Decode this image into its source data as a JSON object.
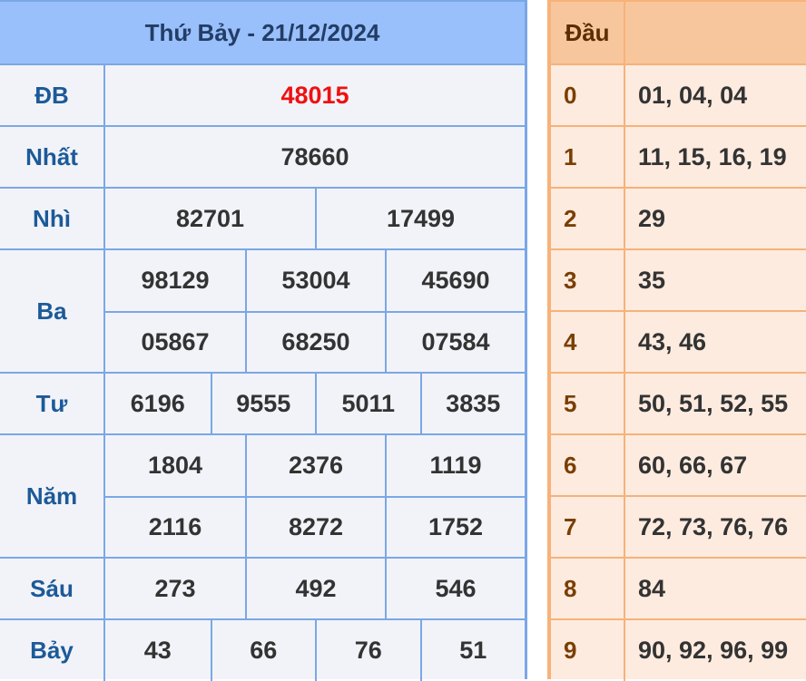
{
  "header": {
    "title": "Thứ Bảy - 21/12/2024"
  },
  "prizes": {
    "db": {
      "label": "ĐB",
      "values": [
        "48015"
      ]
    },
    "nhat": {
      "label": "Nhất",
      "values": [
        "78660"
      ]
    },
    "nhi": {
      "label": "Nhì",
      "values": [
        "82701",
        "17499"
      ]
    },
    "ba": {
      "label": "Ba",
      "values": [
        "98129",
        "53004",
        "45690",
        "05867",
        "68250",
        "07584"
      ]
    },
    "tu": {
      "label": "Tư",
      "values": [
        "6196",
        "9555",
        "5011",
        "3835"
      ]
    },
    "nam": {
      "label": "Năm",
      "values": [
        "1804",
        "2376",
        "1119",
        "2116",
        "8272",
        "1752"
      ]
    },
    "sau": {
      "label": "Sáu",
      "values": [
        "273",
        "492",
        "546"
      ]
    },
    "bay": {
      "label": "Bảy",
      "values": [
        "43",
        "66",
        "76",
        "51"
      ]
    }
  },
  "loto": {
    "header": {
      "dau": "Đầu",
      "duoi": ""
    },
    "rows": [
      {
        "dau": "0",
        "values": "01, 04, 04"
      },
      {
        "dau": "1",
        "values": "11, 15, 16, 19"
      },
      {
        "dau": "2",
        "values": "29"
      },
      {
        "dau": "3",
        "values": "35"
      },
      {
        "dau": "4",
        "values": "43, 46"
      },
      {
        "dau": "5",
        "values": "50, 51, 52, 55"
      },
      {
        "dau": "6",
        "values": "60, 66, 67"
      },
      {
        "dau": "7",
        "values": "72, 73, 76, 76"
      },
      {
        "dau": "8",
        "values": "84"
      },
      {
        "dau": "9",
        "values": "90, 92, 96, 99"
      }
    ]
  },
  "colors": {
    "header_blue": "#99c0fb",
    "border_blue": "#7aa7e6",
    "label_blue": "#1c5a99",
    "special_red": "#ee1111",
    "loto_header": "#f8c69c",
    "loto_bg": "#fdebdf",
    "loto_border": "#f6b27a"
  }
}
